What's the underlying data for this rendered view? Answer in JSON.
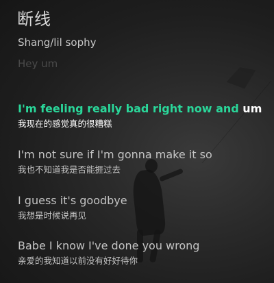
{
  "song": {
    "title": "断线",
    "artist": "Shang/lil sophy"
  },
  "lyrics": {
    "previous": "Hey um",
    "current": {
      "sung": "I'm feeling really bad right now and",
      "upcoming": " um",
      "translation": "我现在的感觉真的很糟糕"
    },
    "lines": [
      {
        "text": "I'm not sure if I'm gonna make it so",
        "translation": "我也不知道我是否能捱过去"
      },
      {
        "text": "I guess it's goodbye",
        "translation": "我想是时候说再见"
      },
      {
        "text": "Babe I know I've done you wrong",
        "translation": "亲爱的我知道以前没有好好待你"
      }
    ]
  },
  "colors": {
    "highlight": "#2ad79a",
    "text": "#c4c4c4",
    "background": "#1b1b1b"
  }
}
